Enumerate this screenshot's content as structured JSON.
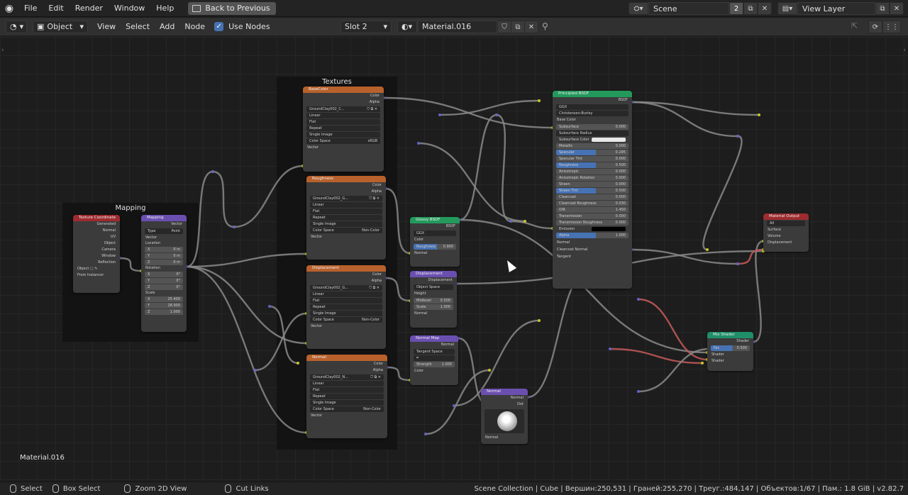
{
  "topbar": {
    "menus": [
      "File",
      "Edit",
      "Render",
      "Window",
      "Help"
    ],
    "back_button": "Back to Previous",
    "scene": "Scene",
    "scene_users": "2",
    "view_layer": "View Layer"
  },
  "header": {
    "mode": "Object",
    "menus": [
      "View",
      "Select",
      "Add",
      "Node"
    ],
    "use_nodes_label": "Use Nodes",
    "slot": "Slot 2",
    "material": "Material.016"
  },
  "frames": {
    "mapping": "Mapping",
    "textures": "Textures"
  },
  "nodes": {
    "texcoord": {
      "title": "Texture Coordinate",
      "outputs": [
        "Generated",
        "Normal",
        "UV",
        "Object",
        "Camera",
        "Window",
        "Reflection"
      ],
      "object_label": "Object",
      "from_instancer": "From Instancer"
    },
    "mapping": {
      "title": "Mapping",
      "out": "Vector",
      "type_label": "Type",
      "type_value": "Point",
      "vector": "Vector",
      "location": "Location",
      "loc": [
        "0 m",
        "0 m",
        "0 m"
      ],
      "rotation": "Rotation",
      "rot": [
        "0°",
        "0°",
        "0°"
      ],
      "scale": "Scale",
      "scl": [
        "25.400",
        "28.900",
        "1.000"
      ],
      "axes": [
        "X",
        "Y",
        "Z"
      ]
    },
    "basecolor": {
      "title": "BaseColor",
      "outs": [
        "Color",
        "Alpha"
      ],
      "image": "GroundClay002_C...",
      "opts": [
        "Linear",
        "Flat",
        "Repeat",
        "Single Image"
      ],
      "cs_label": "Color Space",
      "cs_value": "sRGB",
      "vector": "Vector"
    },
    "roughness": {
      "title": "Roughness",
      "outs": [
        "Color",
        "Alpha"
      ],
      "image": "GroundClay002_G...",
      "opts": [
        "Linear",
        "Flat",
        "Repeat",
        "Single Image"
      ],
      "cs_label": "Color Space",
      "cs_value": "Non-Color",
      "vector": "Vector"
    },
    "displacement_tex": {
      "title": "Displacement",
      "outs": [
        "Color",
        "Alpha"
      ],
      "image": "GroundClay002_G...",
      "opts": [
        "Linear",
        "Flat",
        "Repeat",
        "Single Image"
      ],
      "cs_label": "Color Space",
      "cs_value": "Non-Color",
      "vector": "Vector"
    },
    "normal_tex": {
      "title": "Normal",
      "outs": [
        "Color",
        "Alpha"
      ],
      "image": "GroundClay002_N...",
      "opts": [
        "Linear",
        "Flat",
        "Repeat",
        "Single Image"
      ],
      "cs_label": "Color Space",
      "cs_value": "Non-Color",
      "vector": "Vector"
    },
    "glossy": {
      "title": "Glossy BSDF",
      "out": "BSDF",
      "dist": "GGX",
      "color": "Color",
      "rough_label": "Roughness",
      "rough_value": "0.900",
      "normal": "Normal"
    },
    "displacement": {
      "title": "Displacement",
      "out": "Displacement",
      "space": "Object Space",
      "height": "Height",
      "mid_label": "Midlevel",
      "mid_value": "0.500",
      "scale_label": "Scale",
      "scale_value": "1.000",
      "normal": "Normal"
    },
    "normalmap": {
      "title": "Normal Map",
      "out": "Normal",
      "space": "Tangent Space",
      "str_label": "Strength",
      "str_value": "1.000",
      "color": "Color"
    },
    "normal": {
      "title": "Normal",
      "outs": [
        "Normal",
        "Dot"
      ],
      "input": "Normal"
    },
    "principled": {
      "title": "Principled BSDF",
      "out": "BSDF",
      "dist": "GGX",
      "sss": "Christensen-Burley",
      "basecolor": "Base Color",
      "rows": [
        [
          "Subsurface",
          "0.000"
        ],
        [
          "Subsurface Radius",
          ""
        ],
        [
          "Subsurface Color",
          ""
        ],
        [
          "Metallic",
          "0.000"
        ],
        [
          "Specular",
          "0.295"
        ],
        [
          "Specular Tint",
          "0.000"
        ],
        [
          "Roughness",
          "0.500"
        ],
        [
          "Anisotropic",
          "0.000"
        ],
        [
          "Anisotropic Rotation",
          "0.000"
        ],
        [
          "Sheen",
          "0.000"
        ],
        [
          "Sheen Tint",
          "0.500"
        ],
        [
          "Clearcoat",
          "0.000"
        ],
        [
          "Clearcoat Roughness",
          "0.030"
        ],
        [
          "IOR",
          "1.450"
        ],
        [
          "Transmission",
          "0.000"
        ],
        [
          "Transmission Roughness",
          "0.000"
        ],
        [
          "Emission",
          ""
        ],
        [
          "Alpha",
          "1.000"
        ]
      ],
      "tail": [
        "Normal",
        "Clearcoat Normal",
        "Tangent"
      ]
    },
    "output": {
      "title": "Material Output",
      "target": "All",
      "inputs": [
        "Surface",
        "Volume",
        "Displacement"
      ]
    },
    "mix": {
      "title": "Mix Shader",
      "out": "Shader",
      "fac_label": "Fac",
      "fac_value": "0.500",
      "inputs": [
        "Shader",
        "Shader"
      ]
    }
  },
  "canvas_label": "Material.016",
  "statusbar": {
    "select": "Select",
    "box_select": "Box Select",
    "zoom": "Zoom 2D View",
    "cut": "Cut Links",
    "stats": "Scene Collection | Cube | Вершин:250,531 | Граней:255,270 | Треуг.:484,147 | Объектов:1/67 | Пам.: 1.8 GiB | v2.82.7"
  },
  "colors": {
    "socket_yellow": "#c7c729",
    "socket_purple": "#6363c7",
    "socket_green": "#63c763",
    "wire": "#8a8a8a",
    "wire_red": "#c75b5b"
  }
}
